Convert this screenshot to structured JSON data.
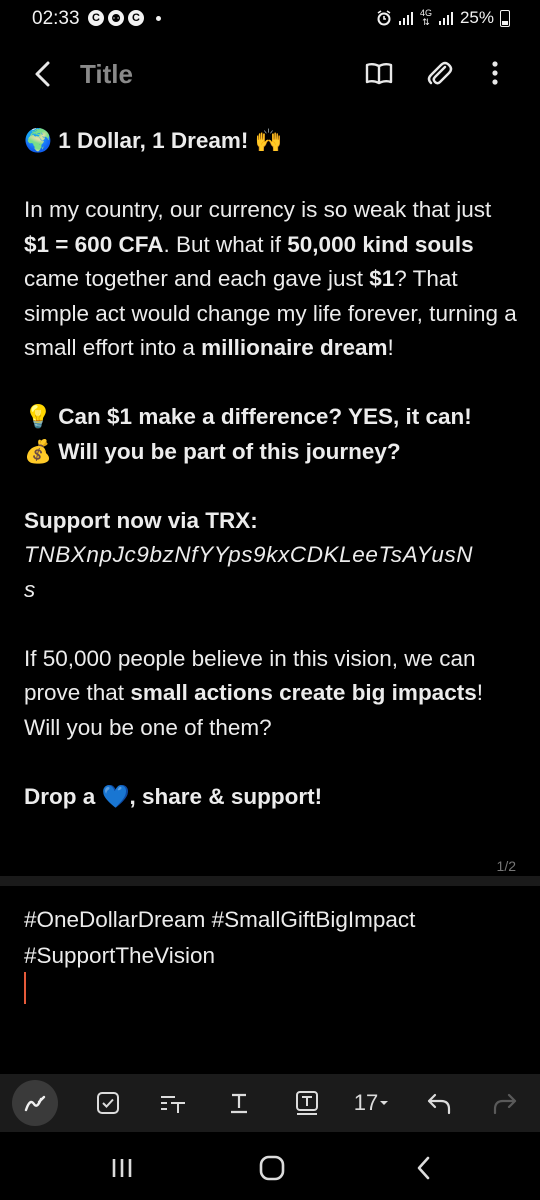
{
  "status_bar": {
    "time": "02:33",
    "app_icons": [
      "C",
      "⚉",
      "C"
    ],
    "network": "4G",
    "battery": "25%"
  },
  "header": {
    "title_placeholder": "Title"
  },
  "note": {
    "heading_text": "1 Dollar, 1 Dream!",
    "heading_emoji_left": "🌍",
    "heading_emoji_right": "🙌",
    "p1": {
      "t1": "In my country, our currency is so weak that just ",
      "b1": "$1 = 600 CFA",
      "t2": ". But what if ",
      "b2": "50,000 kind souls",
      "t3": " came together and each gave just ",
      "b3": "$1",
      "t4": "? That simple act would change my life forever, turning a small effort into a ",
      "b4": "millionaire dream",
      "t5": "!"
    },
    "line_bulb": "Can $1 make a difference? YES, it can!",
    "line_bag": "Will you be part of this journey?",
    "support_label": "Support now via TRX:",
    "trx_address": "TNBXnpJc9bzNfYYps9kxCDKLeeTsAYusNs",
    "p2": {
      "t1": "If 50,000 people believe in this vision, we can prove that ",
      "b1": "small actions create big impacts",
      "t2": "! Will you be one of them?"
    },
    "drop_a": "Drop a ",
    "drop_rest": ", share & support!",
    "page_indicator": "1/2"
  },
  "hashtags": "#OneDollarDream #SmallGiftBigImpact #SupportTheVision",
  "toolbar": {
    "font_size": "17"
  },
  "colors": {
    "background": "#000000",
    "text": "#ececec",
    "cursor": "#e55a3a",
    "heart": "#2f8ee8"
  }
}
